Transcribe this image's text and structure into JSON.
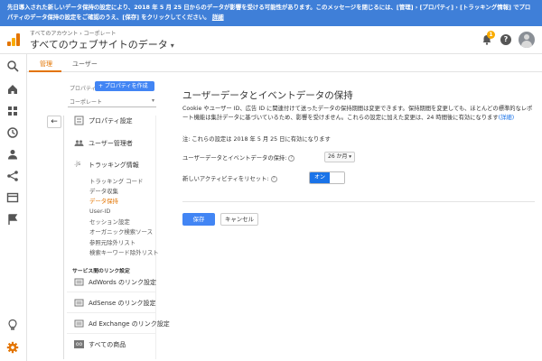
{
  "banner": {
    "text": "先日導入された新しいデータ保持の設定により、2018 年 5 月 25 日からのデータが影響を受ける可能性があります。このメッセージを閉じるには、[管理] › [プロパティ] › [トラッキング情報] でプロパティのデータ保持の設定をご確認のうえ、[保存] をクリックしてください。",
    "link": "詳細"
  },
  "header": {
    "breadcrumb": "すべてのアカウント › コーポレート",
    "property_title": "すべてのウェブサイトのデータ",
    "notification_count": "1",
    "help_label": "?"
  },
  "tabs": [
    {
      "label": "管理",
      "active": true
    },
    {
      "label": "ユーザー",
      "active": false
    }
  ],
  "property_column": {
    "label": "プロパティ",
    "create_button": "+ プロパティを作成",
    "selected": "コーポレート",
    "back_label": "←",
    "menu": [
      {
        "label": "プロパティ設定",
        "icon": "settings-page-icon"
      },
      {
        "label": "ユーザー管理者",
        "icon": "users-icon"
      },
      {
        "label": "トラッキング情報",
        "icon": "js-icon",
        "icon_text": ".js"
      }
    ],
    "tracking_submenu": [
      {
        "label": "トラッキング コード",
        "active": false
      },
      {
        "label": "データ収集",
        "active": false
      },
      {
        "label": "データ保持",
        "active": true
      },
      {
        "label": "User-ID",
        "active": false
      },
      {
        "label": "セッション設定",
        "active": false
      },
      {
        "label": "オーガニック検索ソース",
        "active": false
      },
      {
        "label": "参照元除外リスト",
        "active": false
      },
      {
        "label": "検索キーワード除外リスト",
        "active": false
      }
    ],
    "product_link_section": "サービス間のリンク設定",
    "product_links": [
      {
        "label": "AdWords のリンク設定",
        "icon": "adwords-icon"
      },
      {
        "label": "AdSense のリンク設定",
        "icon": "adsense-icon"
      },
      {
        "label": "Ad Exchange のリンク設定",
        "icon": "adexchange-icon"
      },
      {
        "label": "すべての商品",
        "icon": "all-products-icon",
        "icon_text": "oo"
      }
    ]
  },
  "content": {
    "title": "ユーザーデータとイベントデータの保持",
    "description": "Cookie やユーザー ID、広告 ID に関連付けて送ったデータの保持期間は変更できます。保持期間を変更しても、ほとんどの標準的なレポート機能は集計データに基づいているため、影響を受けません。これらの設定に加えた変更は、24 時間後に有効になります",
    "description_link": "(詳細)",
    "note": "注: これらの設定は 2018 年 5 月 25 日に有効になります",
    "retention_label": "ユーザーデータとイベントデータの保持:",
    "retention_value": "26 か月",
    "reset_label": "新しいアクティビティをリセット:",
    "reset_toggle": "オン",
    "save": "保存",
    "cancel": "キャンセル"
  },
  "colors": {
    "banner": "#3f7fd8",
    "accent_orange": "#e37400",
    "primary_blue": "#4285f4"
  }
}
